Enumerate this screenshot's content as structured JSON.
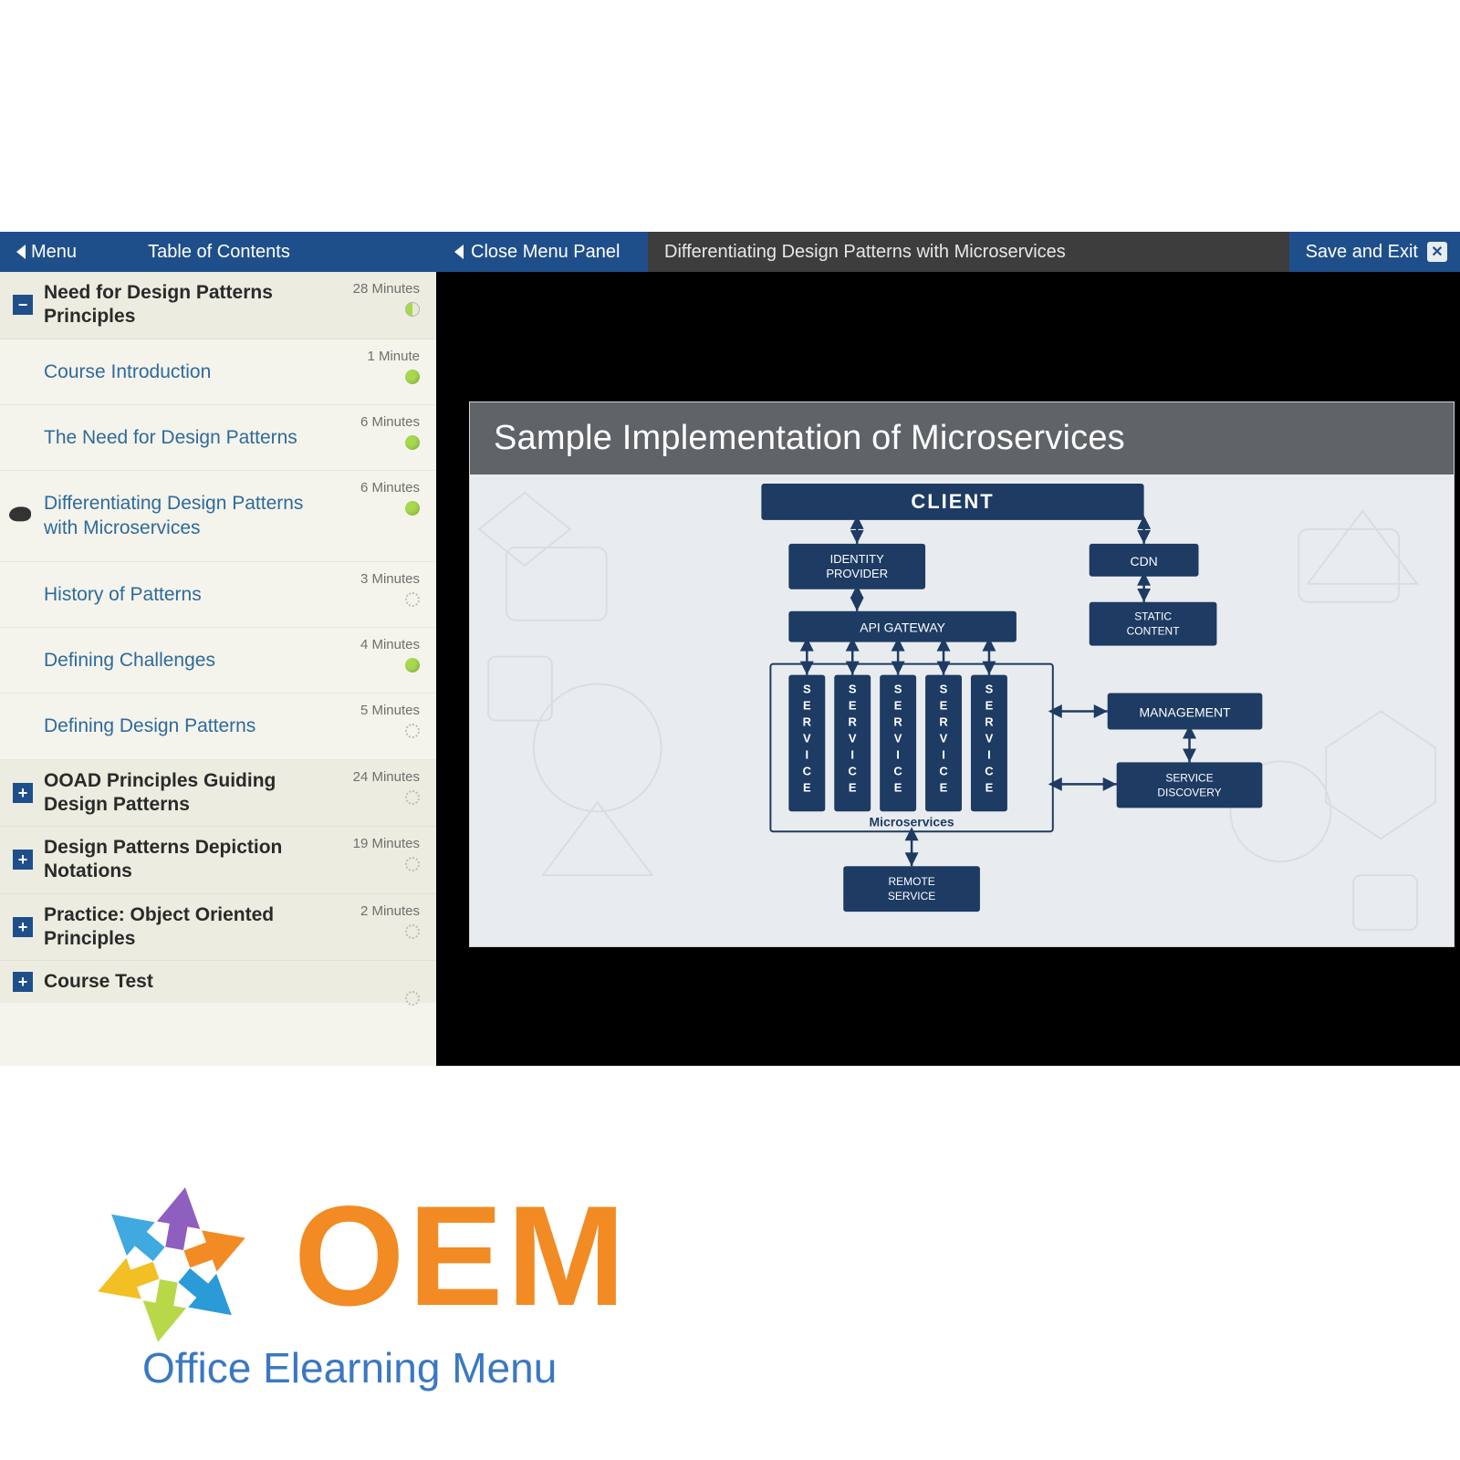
{
  "topbar": {
    "menu_label": "Menu",
    "toc_label": "Table of Contents",
    "close_panel_label": "Close Menu Panel",
    "breadcrumb": "Differentiating Design Patterns with Microservices",
    "save_exit_label": "Save and Exit"
  },
  "sidebar": {
    "sections": [
      {
        "title": "Need for Design Patterns Principles",
        "duration": "28 Minutes",
        "expanded": true,
        "status": "half",
        "lessons": [
          {
            "title": "Course Introduction",
            "duration": "1 Minute",
            "status": "green",
            "current": false
          },
          {
            "title": "The Need for Design Patterns",
            "duration": "6 Minutes",
            "status": "green",
            "current": false
          },
          {
            "title": "Differentiating Design Patterns with Microservices",
            "duration": "6 Minutes",
            "status": "green",
            "current": true
          },
          {
            "title": "History of Patterns",
            "duration": "3 Minutes",
            "status": "outline",
            "current": false
          },
          {
            "title": "Defining Challenges",
            "duration": "4 Minutes",
            "status": "green",
            "current": false
          },
          {
            "title": "Defining Design Patterns",
            "duration": "5 Minutes",
            "status": "outline",
            "current": false
          }
        ]
      },
      {
        "title": "OOAD Principles Guiding Design Patterns",
        "duration": "24 Minutes",
        "expanded": false,
        "status": "outline"
      },
      {
        "title": "Design Patterns Depiction Notations",
        "duration": "19 Minutes",
        "expanded": false,
        "status": "outline"
      },
      {
        "title": "Practice: Object Oriented Principles",
        "duration": "2 Minutes",
        "expanded": false,
        "status": "outline"
      },
      {
        "title": "Course Test",
        "duration": "",
        "expanded": false,
        "status": "outline"
      }
    ]
  },
  "slide": {
    "title": "Sample Implementation of Microservices",
    "nodes": {
      "client": "CLIENT",
      "identity": "IDENTITY PROVIDER",
      "cdn": "CDN",
      "gateway": "API GATEWAY",
      "static": "STATIC CONTENT",
      "service": "SERVICE",
      "micro_label": "Microservices",
      "management": "MANAGEMENT",
      "discovery": "SERVICE DISCOVERY",
      "remote": "REMOTE SERVICE"
    }
  },
  "footer": {
    "brand": "OEM",
    "tagline": "Office Elearning Menu"
  },
  "colors": {
    "navy": "#1d3b63",
    "navy_light": "#27476f",
    "blue_bar": "#1f4f8a",
    "orange": "#f28b24"
  }
}
